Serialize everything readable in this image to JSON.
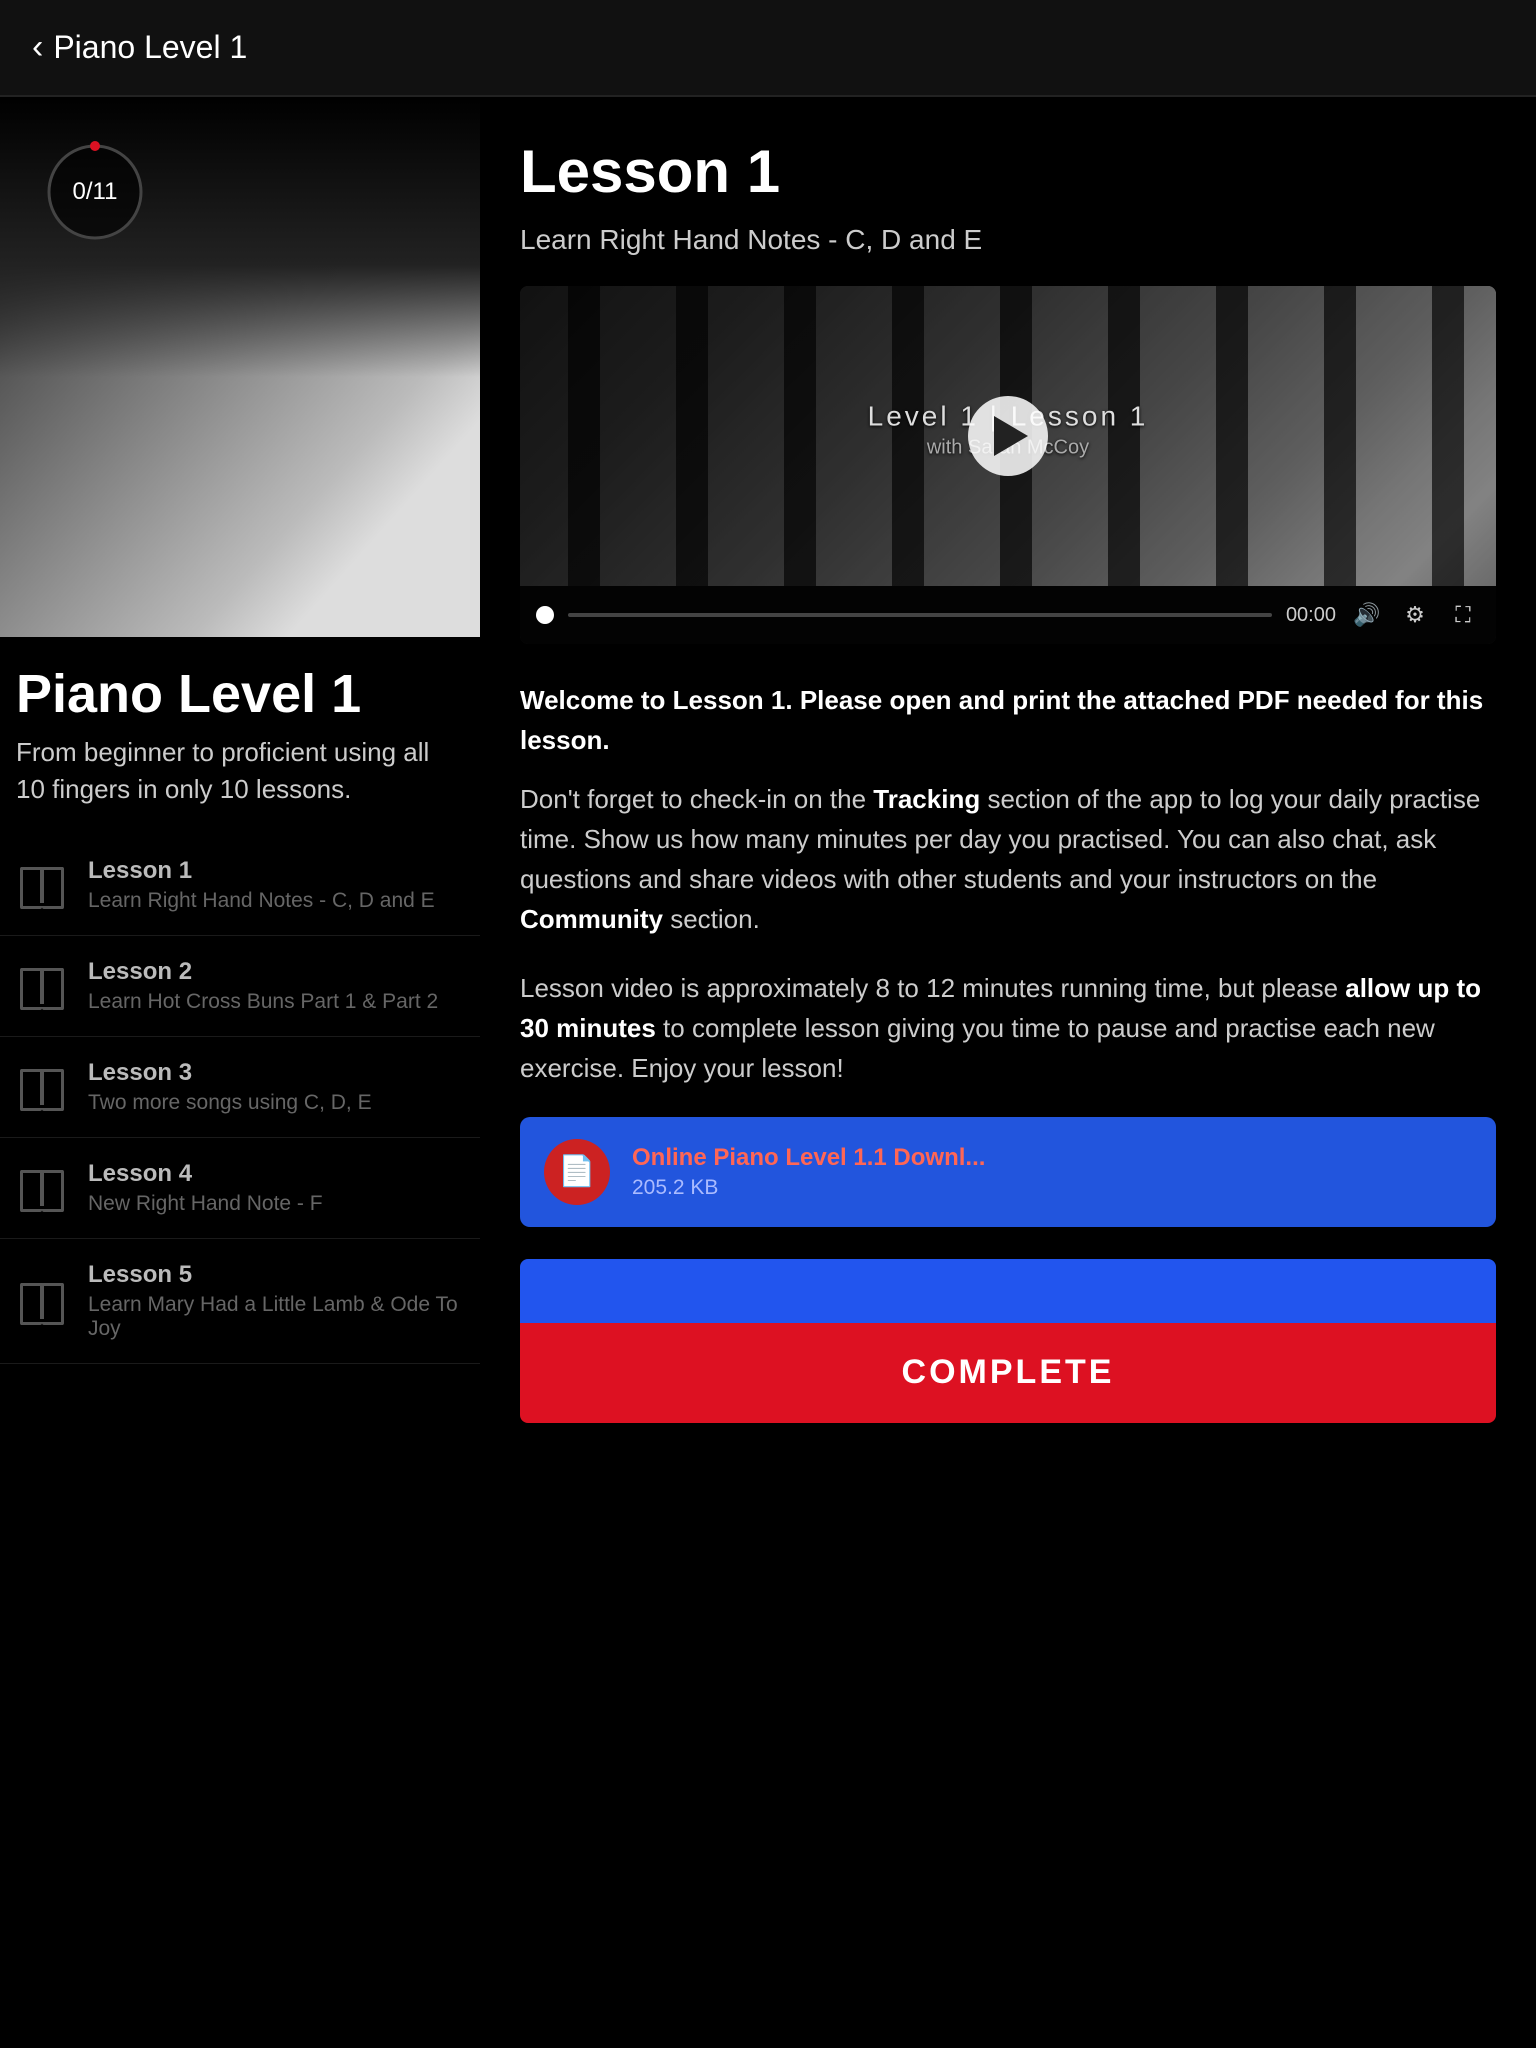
{
  "header": {
    "back_label": "Piano Level 1",
    "back_icon": "‹"
  },
  "left": {
    "progress": {
      "current": 0,
      "total": 11,
      "display": "0/11"
    },
    "course_title": "Piano Level 1",
    "course_subtitle": "From beginner to proficient using all 10 fingers in only 10 lessons.",
    "lessons": [
      {
        "name": "Lesson 1",
        "desc": "Learn Right Hand Notes - C, D and E"
      },
      {
        "name": "Lesson 2",
        "desc": "Learn Hot Cross Buns Part 1 & Part 2"
      },
      {
        "name": "Lesson 3",
        "desc": "Two more songs using C, D, E"
      },
      {
        "name": "Lesson 4",
        "desc": "New Right Hand Note - F"
      },
      {
        "name": "Lesson 5",
        "desc": "Learn Mary Had a Little Lamb & Ode To Joy"
      }
    ]
  },
  "right": {
    "lesson_title": "Lesson 1",
    "lesson_subtitle": "Learn Right Hand Notes - C, D and E",
    "video": {
      "level_label": "Level 1 | Lesson 1",
      "instructor_label": "with Sarah McCoy",
      "time": "00:00",
      "play_label": "▶"
    },
    "description": {
      "bold_intro": "Welcome to Lesson 1. Please open and print the attached PDF needed for this lesson.",
      "para1": "Don't forget to check-in on the Tracking section of the app to log your daily practise time. Show us how many minutes per day you practised. You can also chat, ask questions and share videos with other students and your instructors on the Community section.",
      "para2": "Lesson video is approximately 8 to 12 minutes running time, but please allow up to 30 minutes to complete lesson giving you time to pause and practise each new exercise. Enjoy your lesson!"
    },
    "download": {
      "name": "Online Piano Level 1.1 Downl...",
      "size": "205.2 KB"
    },
    "buttons": {
      "complete_label": "COMPLETE"
    }
  }
}
